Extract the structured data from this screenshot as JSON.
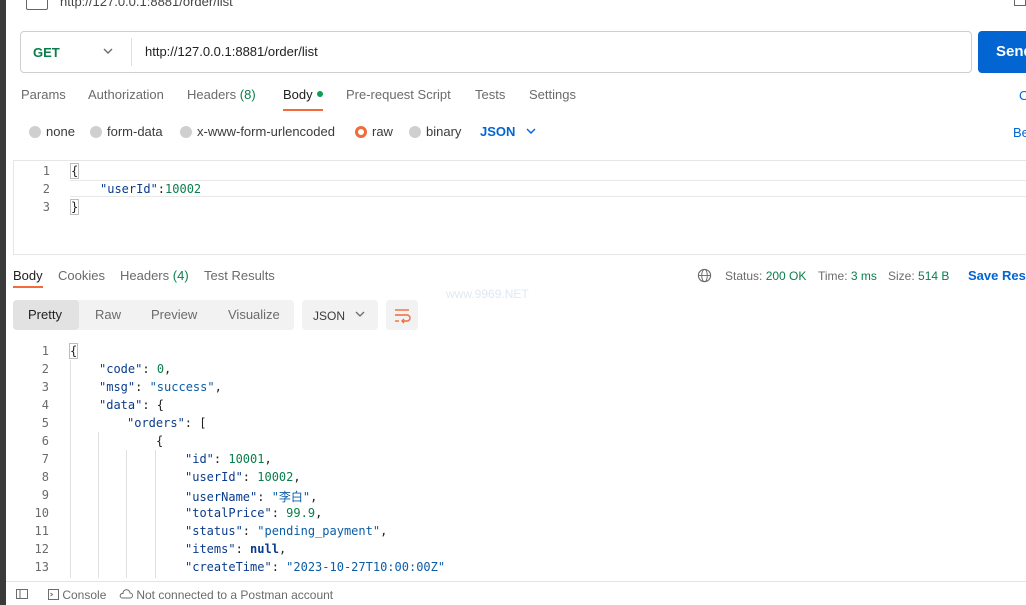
{
  "window": {
    "title_url": "http://127.0.0.1:8881/order/list"
  },
  "request": {
    "method": "GET",
    "url": "http://127.0.0.1:8881/order/list",
    "send_label": "Send",
    "tabs": [
      {
        "label": "Params"
      },
      {
        "label": "Authorization"
      },
      {
        "label": "Headers",
        "count": "(8)"
      },
      {
        "label": "Body"
      },
      {
        "label": "Pre-request Script"
      },
      {
        "label": "Tests"
      },
      {
        "label": "Settings"
      }
    ],
    "right_cut": "C",
    "body_types": [
      "none",
      "form-data",
      "x-www-form-urlencoded",
      "raw",
      "binary"
    ],
    "body_selected": "raw",
    "format": "JSON",
    "beautify": "Be",
    "body_lines": [
      "1",
      "2",
      "3"
    ]
  },
  "response": {
    "tabs": [
      {
        "label": "Body"
      },
      {
        "label": "Cookies"
      },
      {
        "label": "Headers",
        "count": "(4)"
      },
      {
        "label": "Test Results"
      }
    ],
    "status_label": "Status:",
    "status_value": "200 OK",
    "time_label": "Time:",
    "time_value": "3 ms",
    "size_label": "Size:",
    "size_value": "514 B",
    "save_label": "Save Resp",
    "modes": [
      "Pretty",
      "Raw",
      "Preview",
      "Visualize"
    ],
    "format": "JSON",
    "watermark": "www.9969.NET",
    "line_numbers": [
      "1",
      "2",
      "3",
      "4",
      "5",
      "6",
      "7",
      "8",
      "9",
      "10",
      "11",
      "12",
      "13"
    ],
    "json": {
      "code": "0",
      "msg": "\"success\"",
      "id": "10001",
      "userId": "10002",
      "userName": "\"李白\"",
      "totalPrice": "99.9",
      "status": "\"pending_payment\"",
      "items": "null",
      "createTime": "\"2023-10-27T10:00:00Z\""
    }
  },
  "request_json": {
    "key": "\"userId\"",
    "value": "10002"
  },
  "footer": {
    "console": "Console",
    "account": "Not connected to a Postman account"
  }
}
